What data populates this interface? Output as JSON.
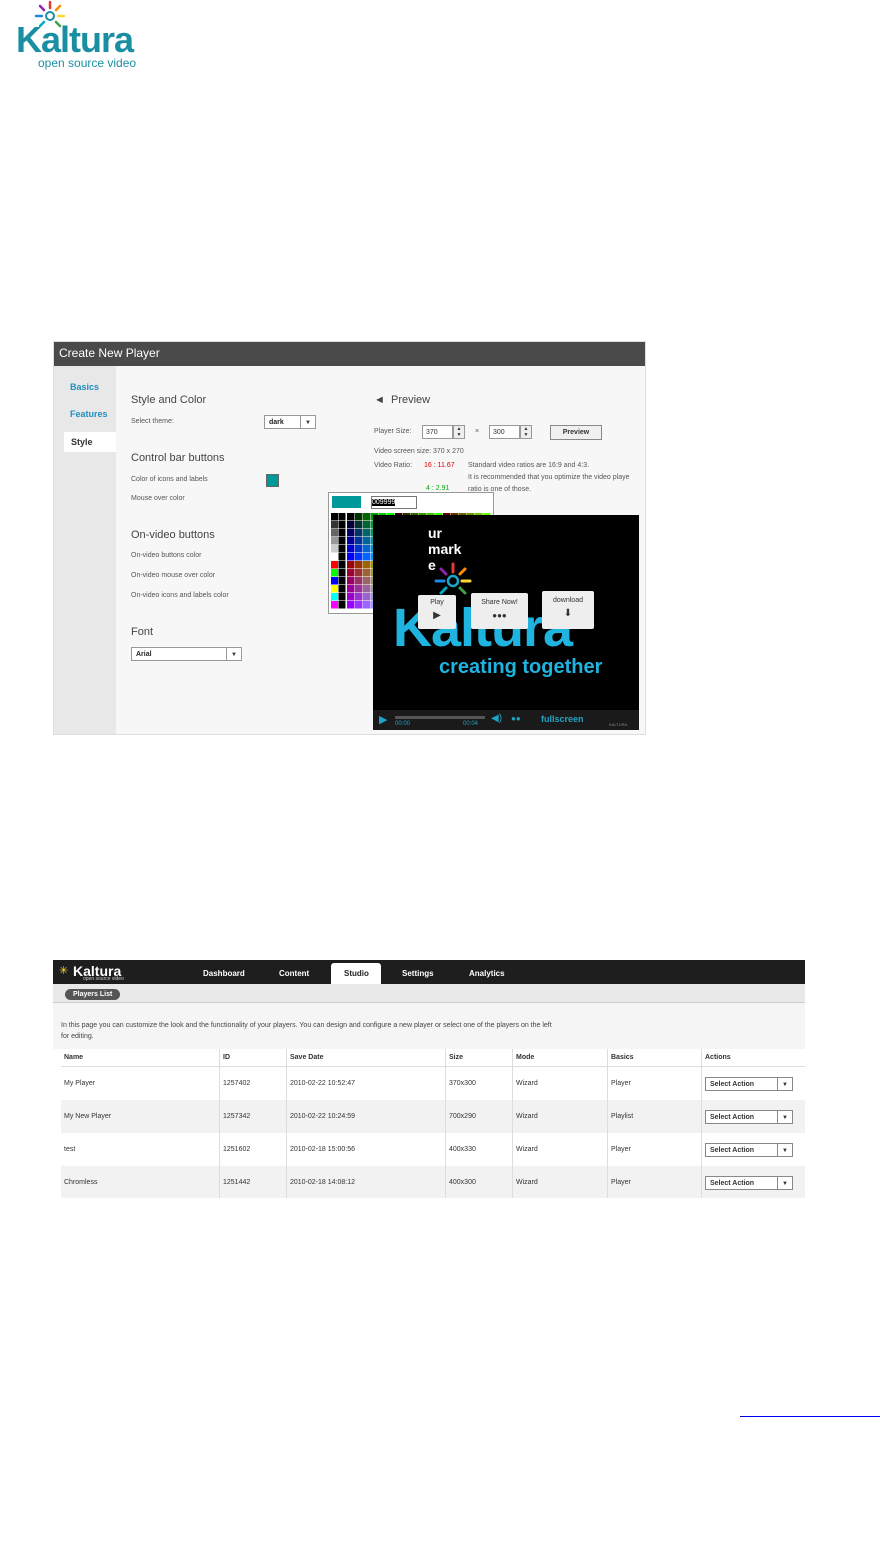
{
  "logo": {
    "word": "Kaltura",
    "tagline": "open source video"
  },
  "create_player": {
    "title": "Create New Player",
    "sidebar": [
      "Basics",
      "Features",
      "Style"
    ],
    "style_color_heading": "Style and Color",
    "select_theme_label": "Select theme:",
    "theme_value": "dark",
    "control_bar_heading": "Control bar buttons",
    "color_icons_label": "Color of icons and labels",
    "mouse_over_label": "Mouse over color",
    "hex_value": "009999",
    "on_video_heading": "On-video buttons",
    "on_video_labels": [
      "On-video buttons color",
      "On-video mouse over color",
      "On-video icons and labels color"
    ],
    "font_heading": "Font",
    "font_value": "Arial",
    "preview_heading": "Preview",
    "player_size_label": "Player Size:",
    "width": "370",
    "times": "×",
    "height": "300",
    "preview_button": "Preview",
    "video_screen_size": "Video screen size: 370 x 270",
    "video_ratio_label": "Video Ratio:",
    "ratio_red": "16 : 11.67",
    "ratio_green": "4 : 2.91",
    "ratio_note_1": "Standard video ratios are 16:9 and 4:3.",
    "ratio_note_2": "It is recommended that you optimize the video playe",
    "ratio_note_3": "ratio is one of those.",
    "video": {
      "text_1": "ur",
      "text_2": "mark",
      "text_3": "e",
      "play_label": "Play",
      "share_label": "Share Now!",
      "download_label": "download",
      "brand": "Kaltura",
      "slogan": "creating together",
      "time_start": "00:00",
      "time_end": "00:04",
      "fullscreen": "fullscreen",
      "mini_logo": "KALTURA"
    }
  },
  "players_list": {
    "logo": "Kaltura",
    "logo_tag": "open source video",
    "nav": [
      "Dashboard",
      "Content",
      "Studio",
      "Settings",
      "Analytics"
    ],
    "breadcrumb": "Players List",
    "description": "In this page you can customize the look and the functionality of your players. You can design and configure a new player or select one of the players on the left for editing.",
    "columns": [
      "Name",
      "ID",
      "Save Date",
      "Size",
      "Mode",
      "Basics",
      "Actions"
    ],
    "rows": [
      {
        "name": "My Player",
        "id": "1257402",
        "date": "2010-02-22 10:52:47",
        "size": "370x300",
        "mode": "Wizard",
        "basics": "Player",
        "action": "Select Action"
      },
      {
        "name": "My New Player",
        "id": "1257342",
        "date": "2010-02-22 10:24:59",
        "size": "700x290",
        "mode": "Wizard",
        "basics": "Playlist",
        "action": "Select Action"
      },
      {
        "name": "test",
        "id": "1251602",
        "date": "2010-02-18 15:00:56",
        "size": "400x330",
        "mode": "Wizard",
        "basics": "Player",
        "action": "Select Action"
      },
      {
        "name": "Chromless",
        "id": "1251442",
        "date": "2010-02-18 14:08:12",
        "size": "400x300",
        "mode": "Wizard",
        "basics": "Player",
        "action": "Select Action"
      }
    ]
  },
  "colors": {
    "brand": "#1a8fa3",
    "swatch": "#009999",
    "link": "#0000ee"
  }
}
